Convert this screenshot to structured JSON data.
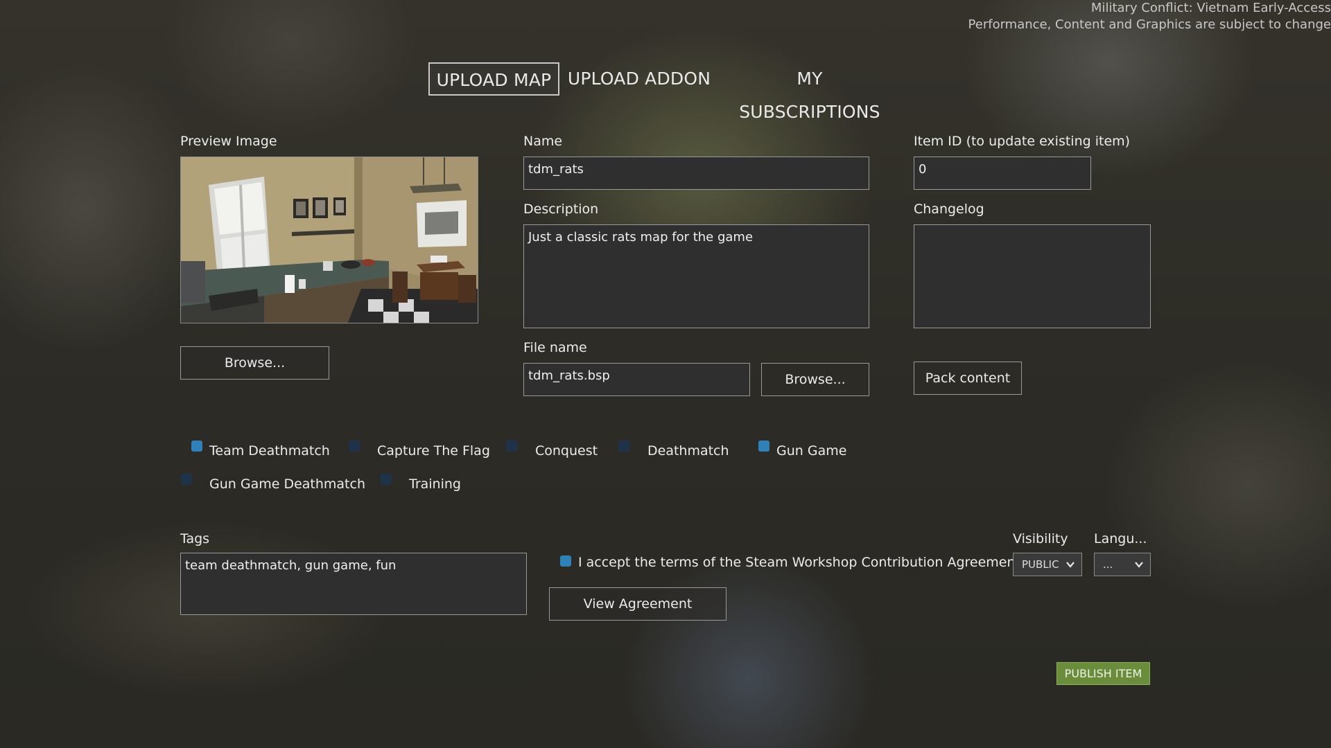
{
  "version_notice": {
    "line1": "Military Conflict: Vietnam Early-Access",
    "line2": "Performance, Content and Graphics are subject to change"
  },
  "tabs": {
    "upload_map": "UPLOAD MAP",
    "upload_addon": "UPLOAD ADDON",
    "my_subscriptions": "MY SUBSCRIPTIONS",
    "active": "UPLOAD MAP"
  },
  "preview": {
    "label": "Preview Image",
    "browse_label": "Browse..."
  },
  "name": {
    "label": "Name",
    "value": "tdm_rats"
  },
  "item_id": {
    "label": "Item ID (to update existing item)",
    "value": "0"
  },
  "description": {
    "label": "Description",
    "value": "Just a classic rats map for the game"
  },
  "changelog": {
    "label": "Changelog",
    "value": ""
  },
  "file": {
    "label": "File name",
    "value": "tdm_rats.bsp",
    "browse_label": "Browse..."
  },
  "pack_content_label": "Pack content",
  "game_modes": [
    {
      "label": "Team Deathmatch",
      "checked": true
    },
    {
      "label": "Capture The Flag",
      "checked": false
    },
    {
      "label": "Conquest",
      "checked": false
    },
    {
      "label": "Deathmatch",
      "checked": false
    },
    {
      "label": "Gun Game",
      "checked": true
    },
    {
      "label": "Gun Game Deathmatch",
      "checked": false
    },
    {
      "label": "Training",
      "checked": false
    }
  ],
  "tags": {
    "label": "Tags",
    "value": "team deathmatch, gun game, fun"
  },
  "agreement": {
    "label": "I accept the terms of the Steam Workshop Contribution Agreement",
    "checked": true,
    "view_label": "View Agreement"
  },
  "visibility": {
    "label": "Visibility",
    "value": "PUBLIC"
  },
  "language": {
    "label": "Langu...",
    "value": "..."
  },
  "publish_label": "PUBLISH ITEM",
  "colors": {
    "checkbox_on": "#2f82b8",
    "checkbox_off": "#1e3249",
    "publish": "#6a8d3b"
  },
  "icons": {
    "dropdown": "chevron-down-icon",
    "checkbox": "checkbox-icon"
  }
}
